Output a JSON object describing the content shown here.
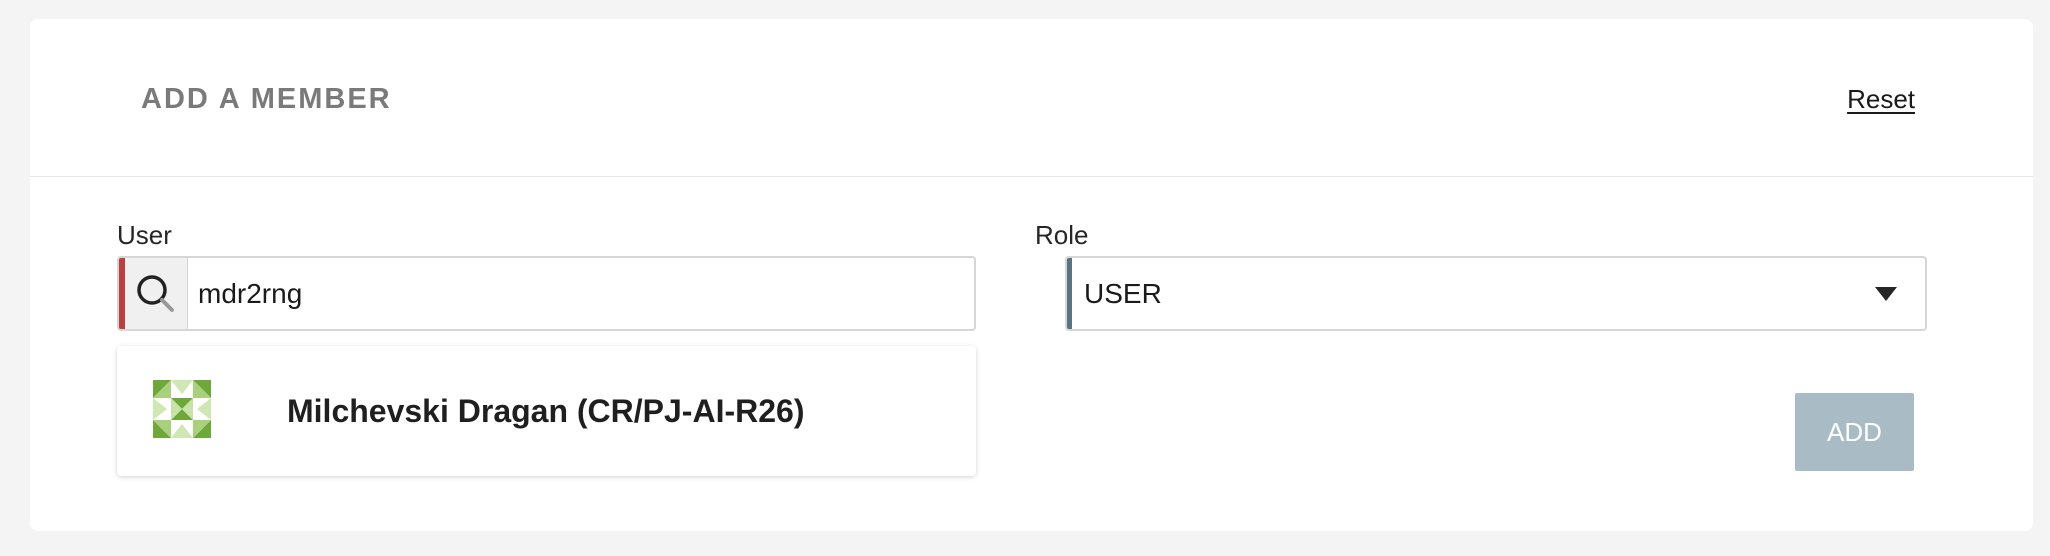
{
  "panel": {
    "title": "ADD A MEMBER",
    "reset_label": "Reset"
  },
  "user": {
    "label": "User",
    "value": "mdr2rng",
    "icon": "search-icon",
    "accent_color": "#b84040"
  },
  "role": {
    "label": "Role",
    "selected": "USER",
    "icon": "chevron-down-icon",
    "accent_color": "#5a7383"
  },
  "suggestions": [
    {
      "name": "Milchevski Dragan (CR/PJ-AI-R26)",
      "avatar": "identicon-avatar"
    }
  ],
  "actions": {
    "add_label": "ADD",
    "add_color": "#a9bcc5"
  }
}
